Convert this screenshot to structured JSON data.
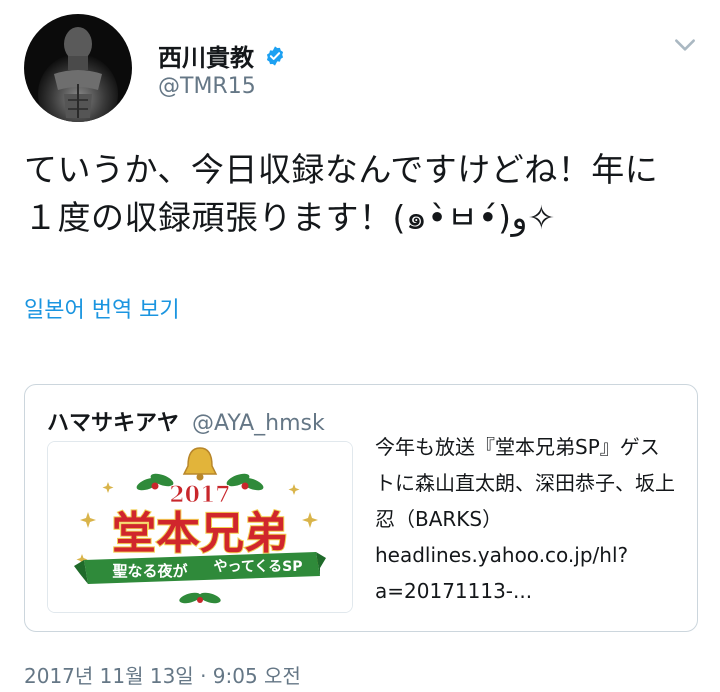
{
  "user": {
    "display_name": "西川貴教",
    "handle": "@TMR15",
    "avatar_icon": "user-avatar-photo",
    "verified_icon": "verified-badge-icon"
  },
  "tweet": {
    "text_line1": "ていうか、今日収録なんですけどね！年に",
    "text_line2": "１度の収録頑張ります！(๑•̀ㅂ•́)و✧"
  },
  "translate_link": "일본어 번역 보기",
  "quoted_tweet": {
    "name": "ハマサキアヤ",
    "handle": "@AYA_hmsk",
    "text": "今年も放送『堂本兄弟SP』ゲストに森山直太朗、深田恭子、坂上忍（BARKS）headlines.yahoo.co.jp/hl?a=20171113-...",
    "image": {
      "year": "2017",
      "title": "堂本兄弟",
      "subtitle_left": "聖なる夜が",
      "subtitle_right": "やってくるSP"
    }
  },
  "timestamp": "2017년 11월 13일 · 9:05 오전",
  "colors": {
    "link": "#1b95e0",
    "verified": "#1da1f2",
    "secondary_text": "#657786",
    "card_border": "#ccd6dd"
  }
}
